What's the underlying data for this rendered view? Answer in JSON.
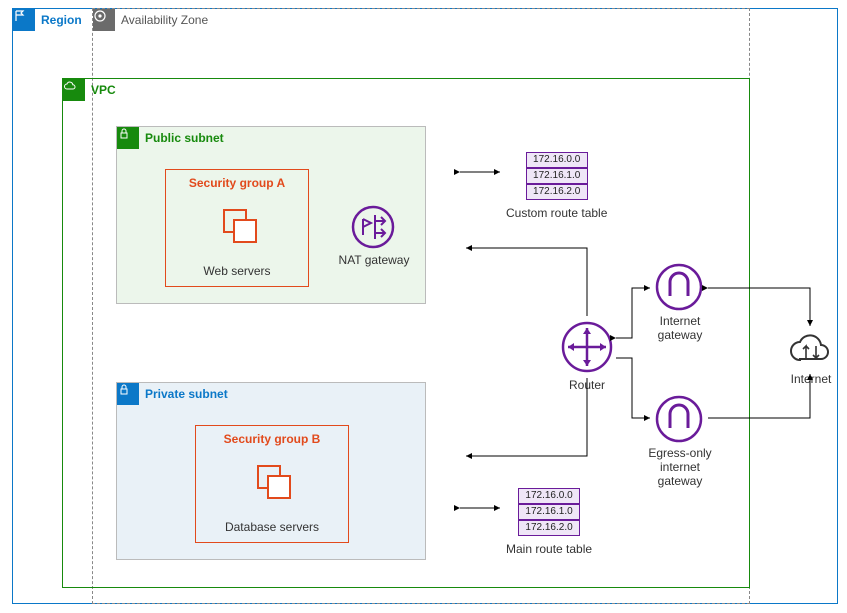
{
  "region": {
    "label": "Region"
  },
  "availability_zone": {
    "label": "Availability Zone"
  },
  "vpc": {
    "label": "VPC"
  },
  "public_subnet": {
    "label": "Public subnet",
    "security_group": {
      "label": "Security group A",
      "servers": "Web servers"
    },
    "nat_gateway": "NAT gateway"
  },
  "private_subnet": {
    "label": "Private subnet",
    "security_group": {
      "label": "Security group B",
      "servers": "Database servers"
    }
  },
  "custom_route_table": {
    "entries": [
      "172.16.0.0",
      "172.16.1.0",
      "172.16.2.0"
    ],
    "caption": "Custom route table"
  },
  "main_route_table": {
    "entries": [
      "172.16.0.0",
      "172.16.1.0",
      "172.16.2.0"
    ],
    "caption": "Main route table"
  },
  "router": "Router",
  "internet_gateway": "Internet gateway",
  "egress_gateway": "Egress-only internet gateway",
  "internet": "Internet"
}
